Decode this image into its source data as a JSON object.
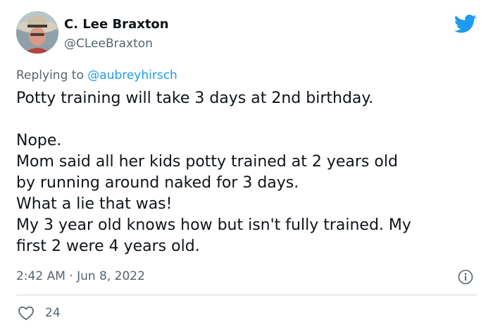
{
  "tweet": {
    "author_name": "C. Lee Braxton",
    "author_handle": "@CLeeBraxton",
    "reply_prefix": "Replying to ",
    "reply_to": "@aubreyhirsch",
    "text_lines": [
      "Potty training will take 3 days at 2nd birthday.",
      "",
      "Nope.",
      "Mom said all her kids potty trained at 2 years old",
      "by running around naked for 3 days.",
      "What a lie that was!",
      "My 3 year old knows how but isn't fully trained. My",
      "first 2 were 4 years old."
    ],
    "timestamp": "2:42 AM · Jun 8, 2022",
    "like_count": "24"
  },
  "icons": {
    "platform": "twitter-bird-icon",
    "info": "info-icon",
    "like": "heart-icon"
  },
  "colors": {
    "brand": "#1d9bf0",
    "text": "#0f1419",
    "secondary": "#536471",
    "divider": "#cfd9de"
  }
}
